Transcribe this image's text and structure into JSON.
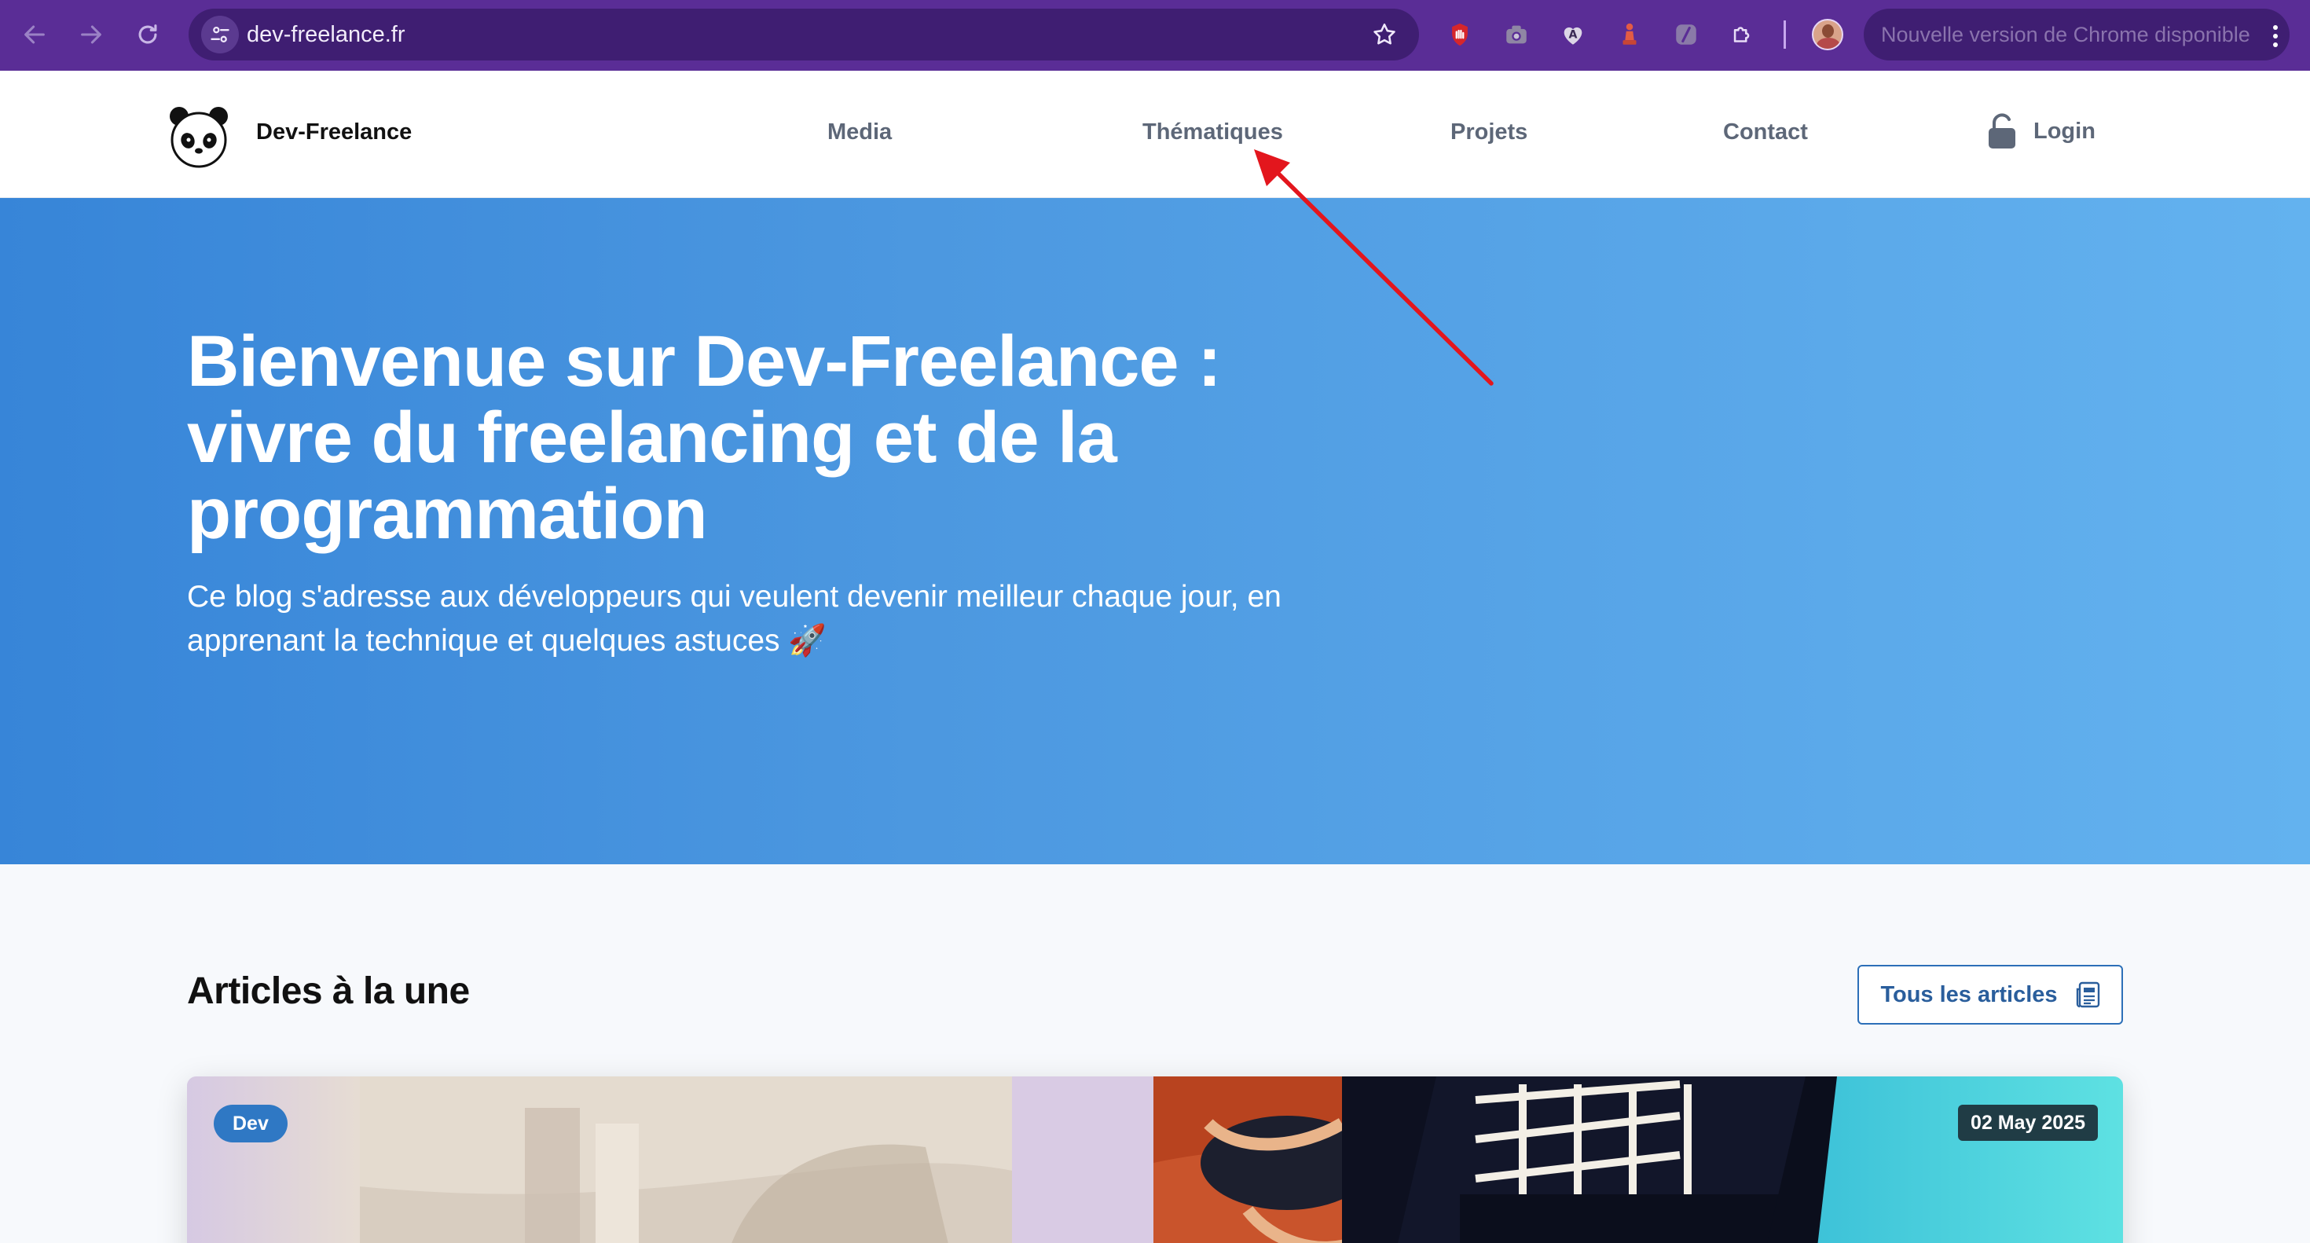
{
  "browser": {
    "url": "dev-freelance.fr",
    "update_notice": "Nouvelle version de Chrome disponible",
    "icons": {
      "back": "arrow-left-icon",
      "forward": "arrow-right-icon",
      "reload": "reload-icon",
      "site_info": "tune-icon",
      "bookmark": "star-icon",
      "extensions": [
        "stop-hand-icon",
        "camera-icon",
        "heart-a-icon",
        "chess-piece-icon",
        "pen-nib-icon",
        "puzzle-icon"
      ],
      "menu": "kebab-menu-icon"
    },
    "colors": {
      "toolbar": "#5a2d96",
      "omnibox": "#3f1e72"
    }
  },
  "header": {
    "brand": "Dev-Freelance",
    "logo_icon": "panda-icon",
    "nav": {
      "media": "Media",
      "thematiques": "Thématiques",
      "projets": "Projets",
      "contact": "Contact",
      "login": "Login"
    },
    "login_icon": "unlocked-padlock-icon"
  },
  "hero": {
    "title": "Bienvenue sur Dev-Freelance : vivre du freelancing et de la programmation",
    "subtitle": "Ce blog s'adresse aux développeurs qui veulent devenir meilleur chaque jour, en apprenant la technique et quelques astuces 🚀",
    "colors": {
      "gradient_start": "#3785d8",
      "gradient_end": "#63b2ef"
    }
  },
  "articles": {
    "title": "Articles à la une",
    "all_button": "Tous les articles",
    "all_button_icon": "newspaper-icon",
    "featured": {
      "tag": "Dev",
      "date": "02 May 2025"
    }
  },
  "annotation": {
    "type": "arrow",
    "color": "#e3161d",
    "points_to": "Thématiques"
  }
}
